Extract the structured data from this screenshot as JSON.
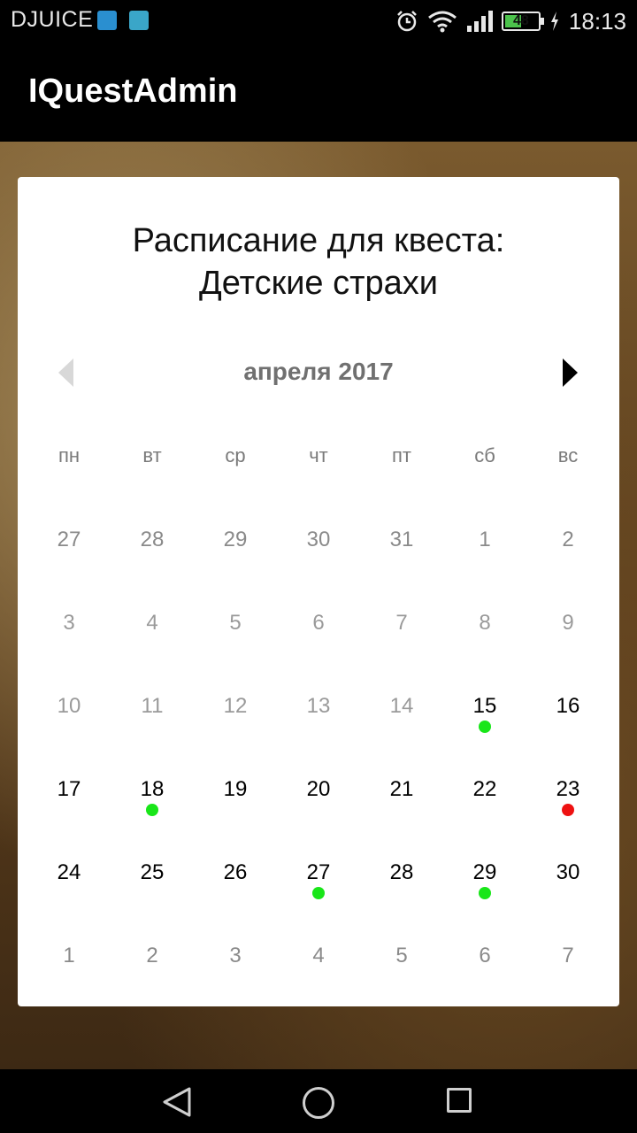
{
  "status_bar": {
    "carrier": "DJUICE",
    "battery_level": "48",
    "time": "18:13",
    "icons": [
      "usb-icon",
      "shield-icon",
      "alarm-icon",
      "wifi-icon",
      "signal-icon",
      "battery-icon",
      "charging-icon"
    ]
  },
  "app_bar": {
    "title": "IQuestAdmin"
  },
  "dialog": {
    "title_line1": "Расписание для квеста:",
    "title_line2": "Детские страхи"
  },
  "calendar": {
    "month_label": "апреля 2017",
    "weekdays": [
      "пн",
      "вт",
      "ср",
      "чт",
      "пт",
      "сб",
      "вс"
    ],
    "weeks": [
      [
        {
          "day": "27",
          "state": "other"
        },
        {
          "day": "28",
          "state": "other"
        },
        {
          "day": "29",
          "state": "other"
        },
        {
          "day": "30",
          "state": "other"
        },
        {
          "day": "31",
          "state": "other"
        },
        {
          "day": "1",
          "state": "other"
        },
        {
          "day": "2",
          "state": "other"
        }
      ],
      [
        {
          "day": "3",
          "state": "past"
        },
        {
          "day": "4",
          "state": "past"
        },
        {
          "day": "5",
          "state": "past"
        },
        {
          "day": "6",
          "state": "past"
        },
        {
          "day": "7",
          "state": "past"
        },
        {
          "day": "8",
          "state": "past"
        },
        {
          "day": "9",
          "state": "past"
        }
      ],
      [
        {
          "day": "10",
          "state": "past"
        },
        {
          "day": "11",
          "state": "past"
        },
        {
          "day": "12",
          "state": "past"
        },
        {
          "day": "13",
          "state": "past"
        },
        {
          "day": "14",
          "state": "past"
        },
        {
          "day": "15",
          "state": "active",
          "dot": "green"
        },
        {
          "day": "16",
          "state": "active"
        }
      ],
      [
        {
          "day": "17",
          "state": "active"
        },
        {
          "day": "18",
          "state": "active",
          "dot": "green"
        },
        {
          "day": "19",
          "state": "active"
        },
        {
          "day": "20",
          "state": "active"
        },
        {
          "day": "21",
          "state": "active"
        },
        {
          "day": "22",
          "state": "active"
        },
        {
          "day": "23",
          "state": "active",
          "dot": "red"
        }
      ],
      [
        {
          "day": "24",
          "state": "active"
        },
        {
          "day": "25",
          "state": "active"
        },
        {
          "day": "26",
          "state": "active"
        },
        {
          "day": "27",
          "state": "active",
          "dot": "green"
        },
        {
          "day": "28",
          "state": "active"
        },
        {
          "day": "29",
          "state": "active",
          "dot": "green"
        },
        {
          "day": "30",
          "state": "active"
        }
      ],
      [
        {
          "day": "1",
          "state": "other"
        },
        {
          "day": "2",
          "state": "other"
        },
        {
          "day": "3",
          "state": "other"
        },
        {
          "day": "4",
          "state": "other"
        },
        {
          "day": "5",
          "state": "other"
        },
        {
          "day": "6",
          "state": "other"
        },
        {
          "day": "7",
          "state": "other"
        }
      ]
    ]
  },
  "colors": {
    "dot_green": "#19e619",
    "dot_red": "#ee1111",
    "active_day": "#000000",
    "inactive_day": "#8a8a8a"
  },
  "nav_bar": {
    "icons": [
      "back-icon",
      "home-icon",
      "recents-icon"
    ]
  }
}
